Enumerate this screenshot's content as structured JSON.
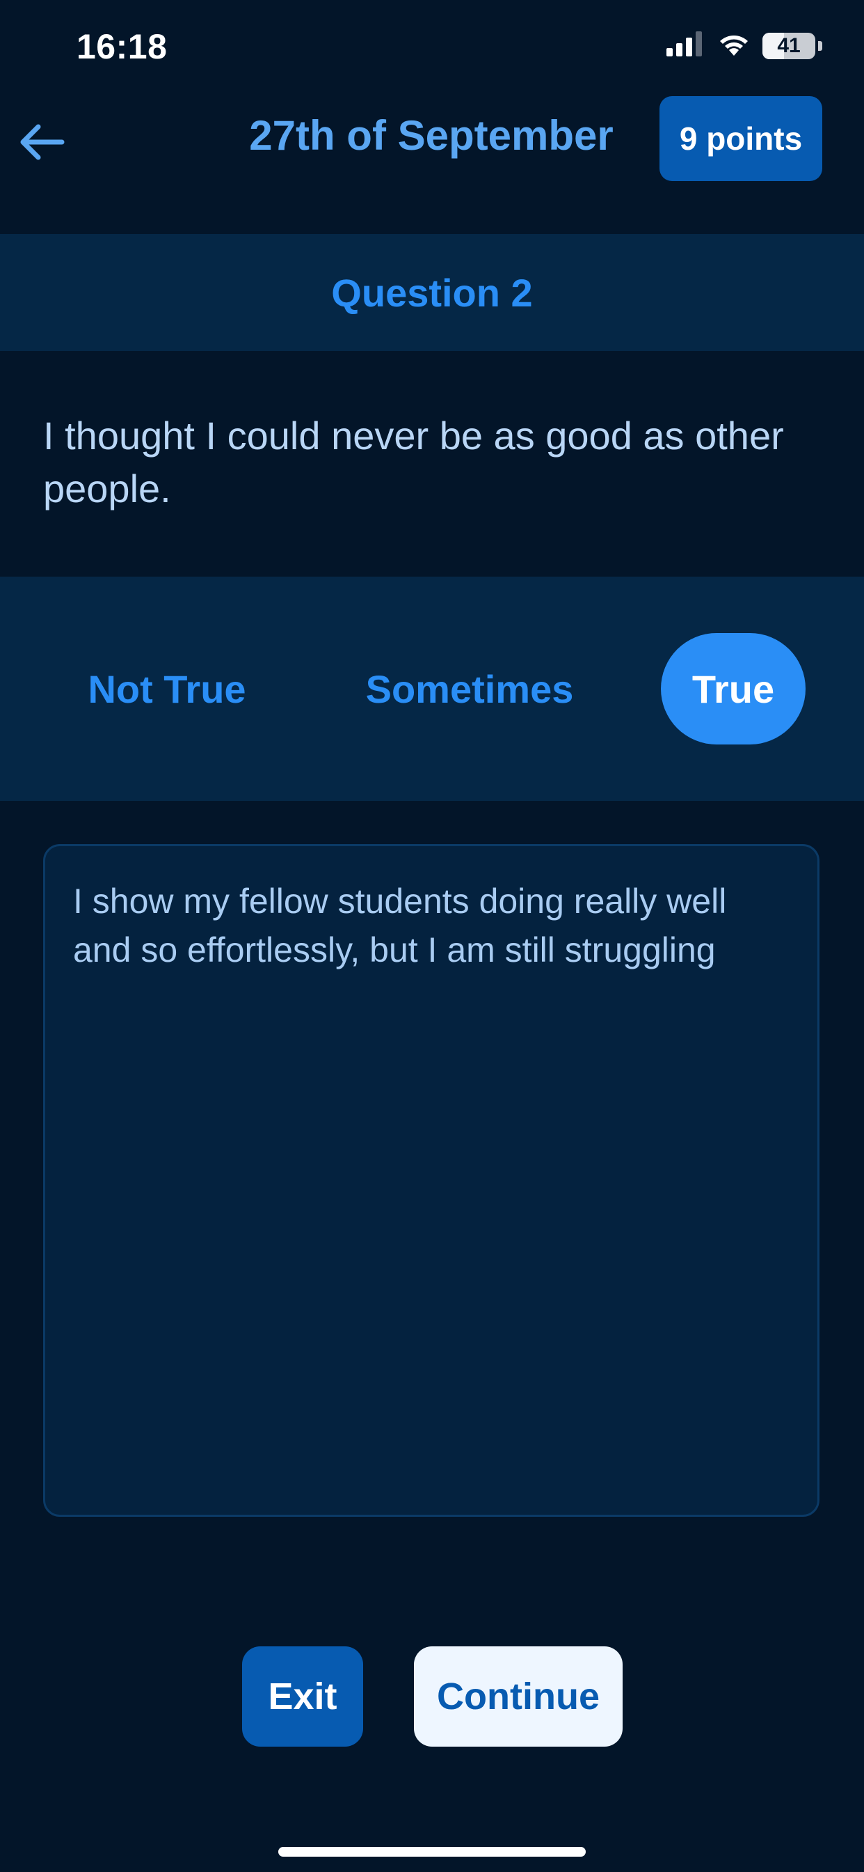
{
  "status_bar": {
    "time": "16:18",
    "battery_level": "41",
    "signal_icon": "cellular-signal-icon",
    "wifi_icon": "wifi-icon",
    "battery_icon": "battery-icon"
  },
  "header": {
    "back_icon": "arrow-left-icon",
    "title": "27th of September",
    "points_label": "9 points"
  },
  "question": {
    "number_label": "Question 2",
    "text": "I thought I could never be as good as other people."
  },
  "answers": {
    "options": [
      "Not True",
      "Sometimes",
      "True"
    ],
    "selected": "True"
  },
  "notes": {
    "value": "I show my fellow students doing really well and so effortlessly, but I am still struggling"
  },
  "actions": {
    "exit_label": "Exit",
    "continue_label": "Continue"
  },
  "colors": {
    "background": "#031529",
    "band": "#052746",
    "accent": "#2a8ef6",
    "primary_button": "#075bb1",
    "light_button": "#eef6ff"
  }
}
